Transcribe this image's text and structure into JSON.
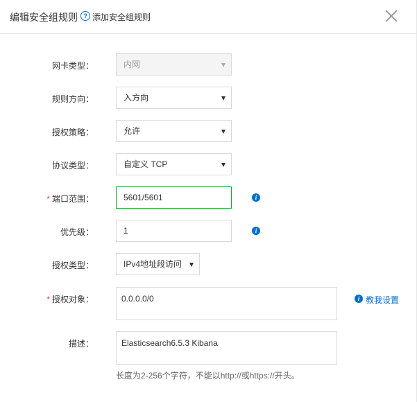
{
  "header": {
    "title": "编辑安全组规则",
    "help_link": "添加安全组规则"
  },
  "form": {
    "nic_type": {
      "label": "网卡类型：",
      "value": "内网"
    },
    "direction": {
      "label": "规则方向：",
      "value": "入方向"
    },
    "policy": {
      "label": "授权策略：",
      "value": "允许"
    },
    "protocol": {
      "label": "协议类型：",
      "value": "自定义 TCP"
    },
    "port_range": {
      "label": "端口范围：",
      "value": "5601/5601",
      "required_mark": "*"
    },
    "priority": {
      "label": "优先级：",
      "value": "1"
    },
    "auth_type": {
      "label": "授权类型：",
      "value": "IPv4地址段访问"
    },
    "auth_object": {
      "label": "授权对象：",
      "value": "0.0.0.0/0",
      "required_mark": "*",
      "help_link": "教我设置"
    },
    "description": {
      "label": "描述：",
      "value": "Elasticsearch6.5.3 Kibana",
      "hint": "长度为2-256个字符，不能以http://或https://开头。"
    }
  },
  "icons": {
    "help": "question-circle-icon",
    "info": "info-circle-icon",
    "close": "close-icon",
    "caret": "caret-down-icon"
  },
  "colors": {
    "link": "#0070cc",
    "required": "#e64b2e",
    "focus_border": "#18a82e"
  }
}
